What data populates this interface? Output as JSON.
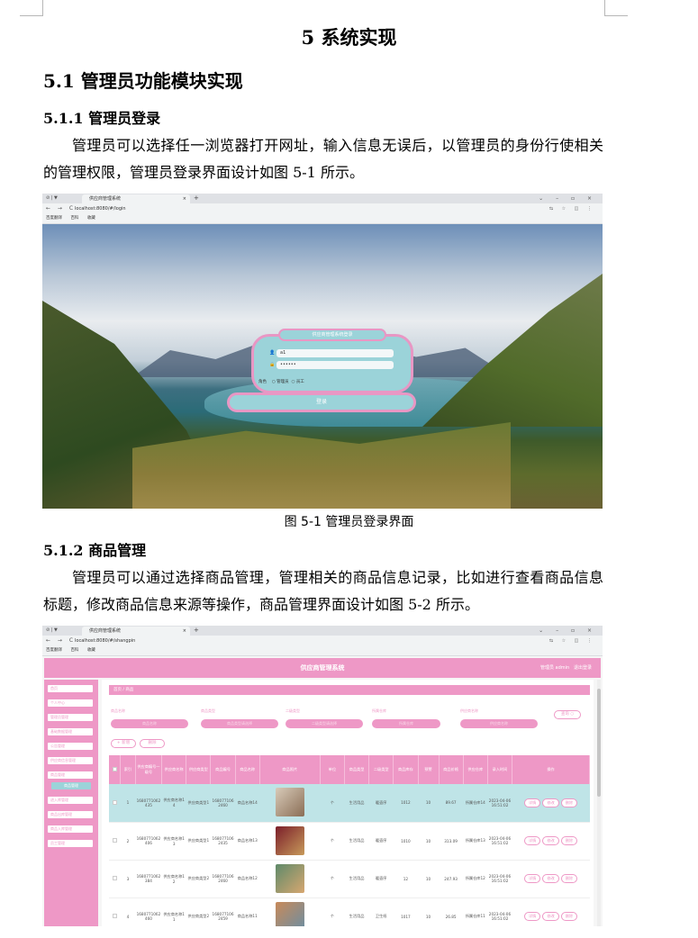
{
  "doc": {
    "chapter_title": "5 系统实现",
    "section_title": "5.1 管理员功能模块实现",
    "sub1_title": "5.1.1 管理员登录",
    "sub1_para": "管理员可以选择任一浏览器打开网址，输入信息无误后，以管理员的身份行使相关的管理权限，管理员登录界面设计如图 5-1 所示。",
    "fig1_caption": "图 5-1 管理员登录界面",
    "sub2_title": "5.1.2 商品管理",
    "sub2_para": "管理员可以通过选择商品管理，管理相关的商品信息记录，比如进行查看商品信息标题，修改商品信息来源等操作，商品管理界面设计如图 5-2 所示。"
  },
  "browser": {
    "tab_title": "供应商管理系统",
    "tab_close": "×",
    "tab_new": "+",
    "tab_controls": "⊘ | ▼",
    "window_controls": "⌄ – ▫ ×",
    "nav_icons": "← → C",
    "url_login": "localhost:8080/#/login",
    "url_goods": "localhost:8080/#/shangpin",
    "url_icons": "⇆ ☆ ◫ ⋮",
    "bookmarks": [
      "百度翻译",
      "百科",
      "收藏"
    ]
  },
  "login": {
    "title": "供应商管理系统登录",
    "username": "a1",
    "password": "••••••",
    "user_icon": "👤",
    "lock_icon": "🔒",
    "role_label": "角色",
    "role_admin": "管理员",
    "role_staff": "员工",
    "submit": "登录"
  },
  "admin": {
    "system_title": "供应商管理系统",
    "user_info": "管理员 admin",
    "logout": "退出登录",
    "breadcrumb": "首页  /  商品",
    "sidebar": [
      "首页",
      "个人中心",
      "管理员管理",
      "基础数据管理",
      "公告管理",
      "供应商信息管理",
      "商品管理",
      "商品管理",
      "进入库管理",
      "商品出库管理",
      "商品入库管理",
      "员工管理"
    ],
    "filters": [
      {
        "label": "商品名称",
        "placeholder": "商品名称"
      },
      {
        "label": "商品类型",
        "placeholder": "商品类型请选择"
      },
      {
        "label": "二级类型",
        "placeholder": "二级类型请选择"
      },
      {
        "label": "所属仓库",
        "placeholder": "所属仓库"
      },
      {
        "label": "供应商名称",
        "placeholder": "供应商名称"
      }
    ],
    "query_button": "查询 ○",
    "add_button": "+ 新增",
    "delete_button": "删除",
    "columns": [
      "",
      "索引",
      "供应商编号一级号",
      "供应商名称",
      "供应商类型",
      "商品编号",
      "商品名称",
      "商品照片",
      "单位",
      "商品类型",
      "二级类型",
      "商品库存",
      "预警",
      "商品价格",
      "供应仓库",
      "录入时间",
      "操作"
    ],
    "rows": [
      {
        "index": "1",
        "supplier_no": "1680771062435",
        "supplier": "供应商名称14",
        "supplier_type": "供应商类型1",
        "goods_no": "1680771062460",
        "goods_name": "商品名称14",
        "unit": "个",
        "type": "生活用品",
        "sub_type": "暖壶序",
        "stock": "1012",
        "warn": "10",
        "price": "89.67",
        "warehouse": "所属仓库14",
        "time": "2023-04-06 16:51:02",
        "thumb_a": "#d8cbb9",
        "thumb_b": "#8a6d55"
      },
      {
        "index": "2",
        "supplier_no": "1680771062406",
        "supplier": "供应商名称13",
        "supplier_type": "供应商类型1",
        "goods_no": "1680771062435",
        "goods_name": "商品名称13",
        "unit": "个",
        "type": "生活用品",
        "sub_type": "暖壶序",
        "stock": "1010",
        "warn": "10",
        "price": "313.09",
        "warehouse": "所属仓库13",
        "time": "2023-04-06 16:51:02",
        "thumb_a": "#7b1e2a",
        "thumb_b": "#c79a5a"
      },
      {
        "index": "3",
        "supplier_no": "1680771062384",
        "supplier": "供应商名称12",
        "supplier_type": "供应商类型2",
        "goods_no": "1680771062460",
        "goods_name": "商品名称12",
        "unit": "个",
        "type": "生活用品",
        "sub_type": "暖壶序",
        "stock": "12",
        "warn": "10",
        "price": "247.93",
        "warehouse": "所属仓库12",
        "time": "2023-04-06 16:51:02",
        "thumb_a": "#5f8a6a",
        "thumb_b": "#d7a770"
      },
      {
        "index": "4",
        "supplier_no": "1680771062460",
        "supplier": "供应商名称11",
        "supplier_type": "供应商类型2",
        "goods_no": "1680771062459",
        "goods_name": "商品名称11",
        "unit": "个",
        "type": "生活用品",
        "sub_type": "卫生纸",
        "stock": "1017",
        "warn": "10",
        "price": "26.85",
        "warehouse": "所属仓库11",
        "time": "2023-04-06 16:51:02",
        "thumb_a": "#c88a5a",
        "thumb_b": "#6b8ea3"
      }
    ],
    "ops": [
      "详情",
      "修改",
      "删除"
    ]
  }
}
